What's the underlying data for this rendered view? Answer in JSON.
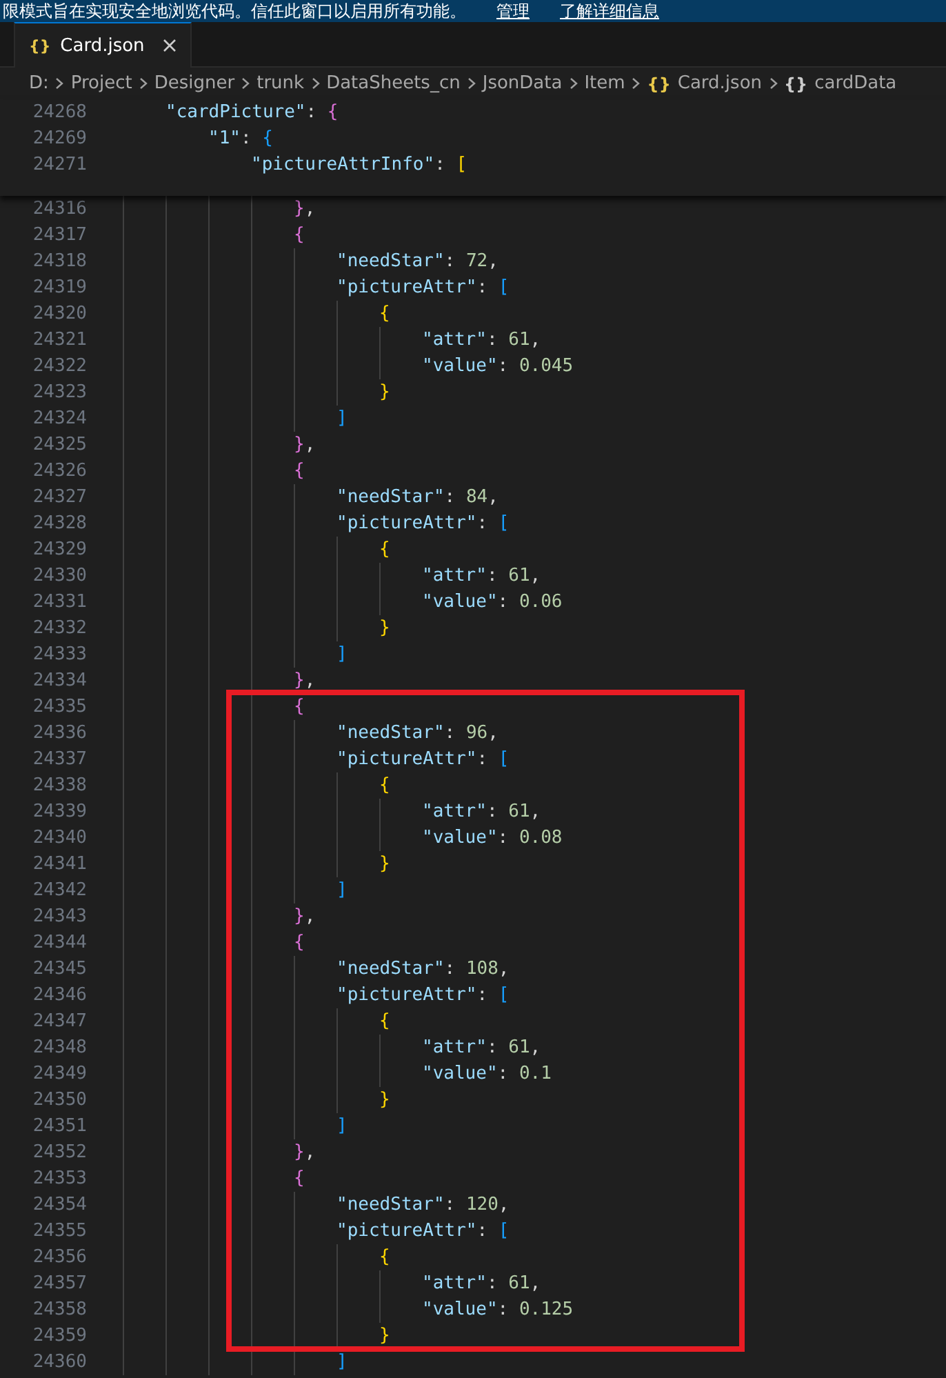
{
  "banner": {
    "message": "限模式旨在实现安全地浏览代码。信任此窗口以启用所有功能。",
    "links": [
      "管理",
      "了解详细信息"
    ]
  },
  "tabs": [
    {
      "icon": "{}",
      "label": "Card.json",
      "selected": true
    }
  ],
  "breadcrumb": [
    {
      "label": "D:"
    },
    {
      "label": "Project"
    },
    {
      "label": "Designer"
    },
    {
      "label": "trunk"
    },
    {
      "label": "DataSheets_cn"
    },
    {
      "label": "JsonData"
    },
    {
      "label": "Item"
    },
    {
      "label": "Card.json",
      "icon": "{}",
      "color": "#e8c84a"
    },
    {
      "label": "cardData",
      "icon": "{}",
      "color": "#cccccc"
    }
  ],
  "sticky_lines": [
    {
      "number": "24268",
      "tokens": [
        {
          "kind": "key",
          "text": "\"cardPicture\""
        },
        {
          "kind": "punct",
          "text": ": "
        },
        {
          "kind": "bracket2",
          "text": "{"
        }
      ],
      "children": [
        {
          "number": "24269",
          "tokens": [
            {
              "kind": "key",
              "text": "\"1\""
            },
            {
              "kind": "punct",
              "text": ": "
            },
            {
              "kind": "bracket3",
              "text": "{"
            }
          ],
          "children": [
            {
              "number": "24271",
              "tokens": [
                {
                  "kind": "key",
                  "text": "\"pictureAttrInfo\""
                },
                {
                  "kind": "punct",
                  "text": ": "
                },
                {
                  "kind": "bracket1",
                  "text": "["
                }
              ]
            }
          ]
        }
      ]
    }
  ],
  "lines": [
    {
      "number": "24316",
      "tokens": [
        {
          "kind": "bracket2",
          "text": "}"
        },
        {
          "kind": "punct",
          "text": ","
        }
      ]
    },
    {
      "number": "24317",
      "tokens": [
        {
          "kind": "bracket2",
          "text": "{"
        }
      ],
      "children": [
        {
          "number": "24318",
          "tokens": [
            {
              "kind": "key",
              "text": "\"needStar\""
            },
            {
              "kind": "punct",
              "text": ": "
            },
            {
              "kind": "num",
              "text": "72"
            },
            {
              "kind": "punct",
              "text": ","
            }
          ]
        },
        {
          "number": "24319",
          "tokens": [
            {
              "kind": "key",
              "text": "\"pictureAttr\""
            },
            {
              "kind": "punct",
              "text": ": "
            },
            {
              "kind": "bracket3",
              "text": "["
            }
          ],
          "children": [
            {
              "number": "24320",
              "tokens": [
                {
                  "kind": "bracket1",
                  "text": "{"
                }
              ],
              "children": [
                {
                  "number": "24321",
                  "tokens": [
                    {
                      "kind": "key",
                      "text": "\"attr\""
                    },
                    {
                      "kind": "punct",
                      "text": ": "
                    },
                    {
                      "kind": "num",
                      "text": "61"
                    },
                    {
                      "kind": "punct",
                      "text": ","
                    }
                  ]
                },
                {
                  "number": "24322",
                  "tokens": [
                    {
                      "kind": "key",
                      "text": "\"value\""
                    },
                    {
                      "kind": "punct",
                      "text": ": "
                    },
                    {
                      "kind": "num",
                      "text": "0.045"
                    }
                  ]
                }
              ]
            },
            {
              "number": "24323",
              "tokens": [
                {
                  "kind": "bracket1",
                  "text": "}"
                }
              ]
            }
          ]
        },
        {
          "number": "24324",
          "tokens": [
            {
              "kind": "bracket3",
              "text": "]"
            }
          ]
        }
      ]
    },
    {
      "number": "24325",
      "tokens": [
        {
          "kind": "bracket2",
          "text": "}"
        },
        {
          "kind": "punct",
          "text": ","
        }
      ]
    },
    {
      "number": "24326",
      "tokens": [
        {
          "kind": "bracket2",
          "text": "{"
        }
      ],
      "children": [
        {
          "number": "24327",
          "tokens": [
            {
              "kind": "key",
              "text": "\"needStar\""
            },
            {
              "kind": "punct",
              "text": ": "
            },
            {
              "kind": "num",
              "text": "84"
            },
            {
              "kind": "punct",
              "text": ","
            }
          ]
        },
        {
          "number": "24328",
          "tokens": [
            {
              "kind": "key",
              "text": "\"pictureAttr\""
            },
            {
              "kind": "punct",
              "text": ": "
            },
            {
              "kind": "bracket3",
              "text": "["
            }
          ],
          "children": [
            {
              "number": "24329",
              "tokens": [
                {
                  "kind": "bracket1",
                  "text": "{"
                }
              ],
              "children": [
                {
                  "number": "24330",
                  "tokens": [
                    {
                      "kind": "key",
                      "text": "\"attr\""
                    },
                    {
                      "kind": "punct",
                      "text": ": "
                    },
                    {
                      "kind": "num",
                      "text": "61"
                    },
                    {
                      "kind": "punct",
                      "text": ","
                    }
                  ]
                },
                {
                  "number": "24331",
                  "tokens": [
                    {
                      "kind": "key",
                      "text": "\"value\""
                    },
                    {
                      "kind": "punct",
                      "text": ": "
                    },
                    {
                      "kind": "num",
                      "text": "0.06"
                    }
                  ]
                }
              ]
            },
            {
              "number": "24332",
              "tokens": [
                {
                  "kind": "bracket1",
                  "text": "}"
                }
              ]
            }
          ]
        },
        {
          "number": "24333",
          "tokens": [
            {
              "kind": "bracket3",
              "text": "]"
            }
          ]
        }
      ]
    },
    {
      "number": "24334",
      "tokens": [
        {
          "kind": "bracket2",
          "text": "}"
        },
        {
          "kind": "punct",
          "text": ","
        }
      ]
    },
    {
      "number": "24335",
      "tokens": [
        {
          "kind": "bracket2",
          "text": "{"
        }
      ],
      "children": [
        {
          "number": "24336",
          "tokens": [
            {
              "kind": "key",
              "text": "\"needStar\""
            },
            {
              "kind": "punct",
              "text": ": "
            },
            {
              "kind": "num",
              "text": "96"
            },
            {
              "kind": "punct",
              "text": ","
            }
          ]
        },
        {
          "number": "24337",
          "tokens": [
            {
              "kind": "key",
              "text": "\"pictureAttr\""
            },
            {
              "kind": "punct",
              "text": ": "
            },
            {
              "kind": "bracket3",
              "text": "["
            }
          ],
          "children": [
            {
              "number": "24338",
              "tokens": [
                {
                  "kind": "bracket1",
                  "text": "{"
                }
              ],
              "children": [
                {
                  "number": "24339",
                  "tokens": [
                    {
                      "kind": "key",
                      "text": "\"attr\""
                    },
                    {
                      "kind": "punct",
                      "text": ": "
                    },
                    {
                      "kind": "num",
                      "text": "61"
                    },
                    {
                      "kind": "punct",
                      "text": ","
                    }
                  ]
                },
                {
                  "number": "24340",
                  "tokens": [
                    {
                      "kind": "key",
                      "text": "\"value\""
                    },
                    {
                      "kind": "punct",
                      "text": ": "
                    },
                    {
                      "kind": "num",
                      "text": "0.08"
                    }
                  ]
                }
              ]
            },
            {
              "number": "24341",
              "tokens": [
                {
                  "kind": "bracket1",
                  "text": "}"
                }
              ]
            }
          ]
        },
        {
          "number": "24342",
          "tokens": [
            {
              "kind": "bracket3",
              "text": "]"
            }
          ]
        }
      ]
    },
    {
      "number": "24343",
      "tokens": [
        {
          "kind": "bracket2",
          "text": "}"
        },
        {
          "kind": "punct",
          "text": ","
        }
      ]
    },
    {
      "number": "24344",
      "tokens": [
        {
          "kind": "bracket2",
          "text": "{"
        }
      ],
      "children": [
        {
          "number": "24345",
          "tokens": [
            {
              "kind": "key",
              "text": "\"needStar\""
            },
            {
              "kind": "punct",
              "text": ": "
            },
            {
              "kind": "num",
              "text": "108"
            },
            {
              "kind": "punct",
              "text": ","
            }
          ]
        },
        {
          "number": "24346",
          "tokens": [
            {
              "kind": "key",
              "text": "\"pictureAttr\""
            },
            {
              "kind": "punct",
              "text": ": "
            },
            {
              "kind": "bracket3",
              "text": "["
            }
          ],
          "children": [
            {
              "number": "24347",
              "tokens": [
                {
                  "kind": "bracket1",
                  "text": "{"
                }
              ],
              "children": [
                {
                  "number": "24348",
                  "tokens": [
                    {
                      "kind": "key",
                      "text": "\"attr\""
                    },
                    {
                      "kind": "punct",
                      "text": ": "
                    },
                    {
                      "kind": "num",
                      "text": "61"
                    },
                    {
                      "kind": "punct",
                      "text": ","
                    }
                  ]
                },
                {
                  "number": "24349",
                  "tokens": [
                    {
                      "kind": "key",
                      "text": "\"value\""
                    },
                    {
                      "kind": "punct",
                      "text": ": "
                    },
                    {
                      "kind": "num",
                      "text": "0.1"
                    }
                  ]
                }
              ]
            },
            {
              "number": "24350",
              "tokens": [
                {
                  "kind": "bracket1",
                  "text": "}"
                }
              ]
            }
          ]
        },
        {
          "number": "24351",
          "tokens": [
            {
              "kind": "bracket3",
              "text": "]"
            }
          ]
        }
      ]
    },
    {
      "number": "24352",
      "tokens": [
        {
          "kind": "bracket2",
          "text": "}"
        },
        {
          "kind": "punct",
          "text": ","
        }
      ]
    },
    {
      "number": "24353",
      "tokens": [
        {
          "kind": "bracket2",
          "text": "{"
        }
      ],
      "children": [
        {
          "number": "24354",
          "tokens": [
            {
              "kind": "key",
              "text": "\"needStar\""
            },
            {
              "kind": "punct",
              "text": ": "
            },
            {
              "kind": "num",
              "text": "120"
            },
            {
              "kind": "punct",
              "text": ","
            }
          ]
        },
        {
          "number": "24355",
          "tokens": [
            {
              "kind": "key",
              "text": "\"pictureAttr\""
            },
            {
              "kind": "punct",
              "text": ": "
            },
            {
              "kind": "bracket3",
              "text": "["
            }
          ],
          "children": [
            {
              "number": "24356",
              "tokens": [
                {
                  "kind": "bracket1",
                  "text": "{"
                }
              ],
              "children": [
                {
                  "number": "24357",
                  "tokens": [
                    {
                      "kind": "key",
                      "text": "\"attr\""
                    },
                    {
                      "kind": "punct",
                      "text": ": "
                    },
                    {
                      "kind": "num",
                      "text": "61"
                    },
                    {
                      "kind": "punct",
                      "text": ","
                    }
                  ]
                },
                {
                  "number": "24358",
                  "tokens": [
                    {
                      "kind": "key",
                      "text": "\"value\""
                    },
                    {
                      "kind": "punct",
                      "text": ": "
                    },
                    {
                      "kind": "num",
                      "text": "0.125"
                    }
                  ]
                }
              ]
            },
            {
              "number": "24359",
              "tokens": [
                {
                  "kind": "bracket1",
                  "text": "}"
                }
              ]
            }
          ]
        },
        {
          "number": "24360",
          "tokens": [
            {
              "kind": "bracket3",
              "text": "]"
            }
          ]
        }
      ]
    }
  ],
  "highlight": {
    "color": "#e81c24"
  }
}
